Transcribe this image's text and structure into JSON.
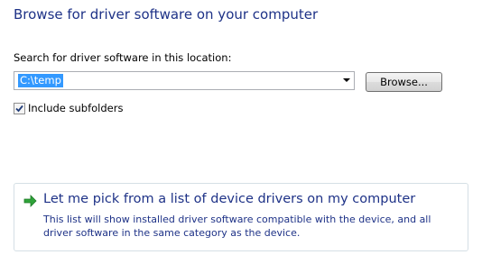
{
  "heading": "Browse for driver software on your computer",
  "search": {
    "label": "Search for driver software in this location:",
    "value": "C:\\temp"
  },
  "browse_button": "Browse...",
  "include_subfolders": {
    "label": "Include subfolders",
    "checked": true
  },
  "pick_option": {
    "title": "Let me pick from a list of device drivers on my computer",
    "description": "This list will show installed driver software compatible with the device, and all driver software in the same category as the device."
  },
  "colors": {
    "heading": "#1e3287",
    "selection": "#3399ff",
    "arrow_icon": "#2fa33a"
  }
}
